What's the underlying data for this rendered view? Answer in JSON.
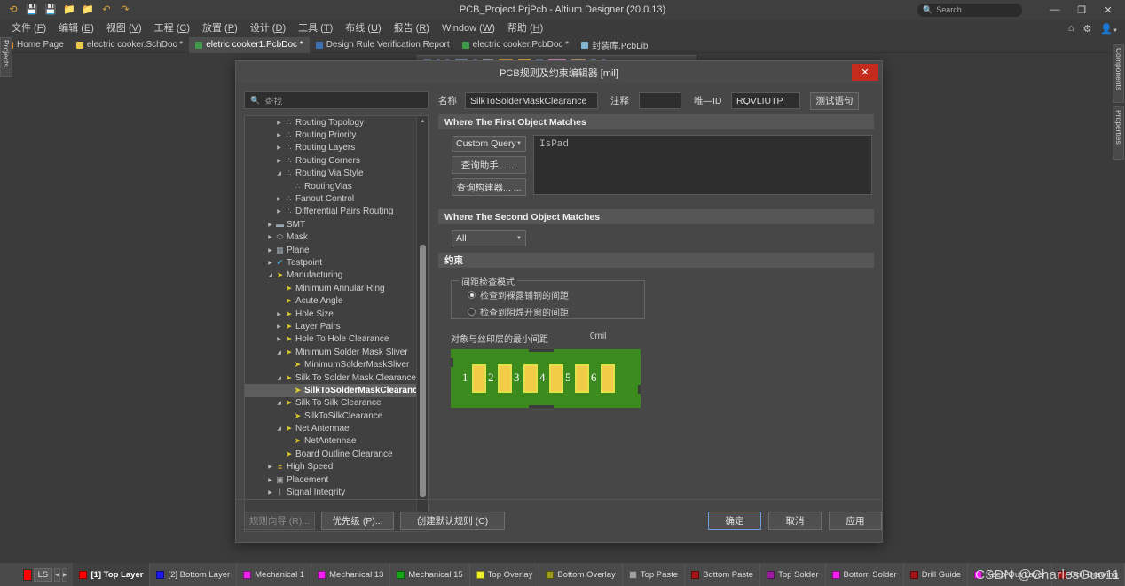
{
  "titlebar": {
    "title": "PCB_Project.PrjPcb - Altium Designer (20.0.13)",
    "search_placeholder": "Search",
    "minimize": "—",
    "maximize": "❐",
    "close": "✕",
    "icons": [
      "logo-icon",
      "save-icon",
      "save-all-icon",
      "open-icon",
      "open-project-icon",
      "undo-icon",
      "redo-icon"
    ]
  },
  "menubar": {
    "items": [
      {
        "text": "文件",
        "key": "F"
      },
      {
        "text": "编辑",
        "key": "E"
      },
      {
        "text": "视图",
        "key": "V"
      },
      {
        "text": "工程",
        "key": "C"
      },
      {
        "text": "放置",
        "key": "P"
      },
      {
        "text": "设计",
        "key": "D"
      },
      {
        "text": "工具",
        "key": "T"
      },
      {
        "text": "布线",
        "key": "U"
      },
      {
        "text": "报告",
        "key": "R"
      },
      {
        "text": "Window",
        "key": "W"
      },
      {
        "text": "帮助",
        "key": "H"
      }
    ],
    "right_icons": [
      "home-icon",
      "gear-icon",
      "account-icon"
    ]
  },
  "tabs": [
    {
      "label": "Home Page",
      "icon_color": "#e08a2e",
      "active": false
    },
    {
      "label": "electric cooker.SchDoc *",
      "icon_color": "#e8c84a",
      "active": false
    },
    {
      "label": "eletric cooker1.PcbDoc *",
      "icon_color": "#3f9a4a",
      "active": true
    },
    {
      "label": "Design Rule Verification Report",
      "icon_color": "#3d6fb5",
      "active": false
    },
    {
      "label": "electric cooker.PcbDoc *",
      "icon_color": "#3f9a4a",
      "active": false
    },
    {
      "label": "封装库.PcbLib",
      "icon_color": "#7fb7d4",
      "active": false
    }
  ],
  "panels": {
    "left_vertical": "Projects",
    "right_vertical": [
      "Components",
      "Properties"
    ]
  },
  "dialog": {
    "title": "PCB规则及约束编辑器 [mil]",
    "close_label": "✕",
    "search_placeholder": "查找",
    "fields": {
      "name_label": "名称",
      "name_value": "SilkToSolderMaskClearance",
      "comment_label": "注释",
      "comment_value": "",
      "uid_label": "唯—ID",
      "uid_value": "RQVLIUTP",
      "test_button": "测试语句"
    },
    "first_object": {
      "header": "Where The First Object Matches",
      "scope": "Custom Query",
      "query_helper_button": "查询助手... ...",
      "query_builder_button": "查询构建器... ...",
      "query_text": "IsPad"
    },
    "second_object": {
      "header": "Where The Second Object Matches",
      "scope": "All"
    },
    "constraints": {
      "header": "约束",
      "group_legend": "间距检查模式",
      "options": [
        {
          "label": "检查到裸露铺铜的间距",
          "selected": true
        },
        {
          "label": "检查到阻焊开窗的间距",
          "selected": false
        }
      ],
      "clearance_label": "对象与丝印层的最小间距",
      "clearance_value": "0mil"
    },
    "preview": {
      "pad_labels": [
        "1",
        "2",
        "3",
        "4",
        "5",
        "6"
      ],
      "board_color": "#3b8a1e",
      "pad_color": "#f2cc47"
    },
    "footer": {
      "rule_wizard": "规则向导 (R)...",
      "priority": "优先级 (P)...",
      "create_default": "创建默认规则 (C)",
      "ok": "确定",
      "cancel": "取消",
      "apply": "应用"
    }
  },
  "tree": [
    {
      "depth": 3,
      "label": "Routing Topology",
      "expander": "collapsed",
      "icon": "routing-icon"
    },
    {
      "depth": 3,
      "label": "Routing Priority",
      "expander": "collapsed",
      "icon": "routing-icon"
    },
    {
      "depth": 3,
      "label": "Routing Layers",
      "expander": "collapsed",
      "icon": "routing-icon"
    },
    {
      "depth": 3,
      "label": "Routing Corners",
      "expander": "collapsed",
      "icon": "routing-icon"
    },
    {
      "depth": 3,
      "label": "Routing Via Style",
      "expander": "expanded",
      "icon": "routing-icon"
    },
    {
      "depth": 4,
      "label": "RoutingVias",
      "expander": "none",
      "icon": "routing-icon"
    },
    {
      "depth": 3,
      "label": "Fanout Control",
      "expander": "collapsed",
      "icon": "routing-icon"
    },
    {
      "depth": 3,
      "label": "Differential Pairs Routing",
      "expander": "collapsed",
      "icon": "routing-icon"
    },
    {
      "depth": 2,
      "label": "SMT",
      "expander": "collapsed",
      "icon": "smt-icon"
    },
    {
      "depth": 2,
      "label": "Mask",
      "expander": "collapsed",
      "icon": "mask-icon"
    },
    {
      "depth": 2,
      "label": "Plane",
      "expander": "collapsed",
      "icon": "plane-icon"
    },
    {
      "depth": 2,
      "label": "Testpoint",
      "expander": "collapsed",
      "icon": "testpoint-icon"
    },
    {
      "depth": 2,
      "label": "Manufacturing",
      "expander": "expanded",
      "icon": "manufacturing-icon"
    },
    {
      "depth": 3,
      "label": "Minimum Annular Ring",
      "expander": "none",
      "icon": "manufacturing-icon"
    },
    {
      "depth": 3,
      "label": "Acute Angle",
      "expander": "none",
      "icon": "manufacturing-icon"
    },
    {
      "depth": 3,
      "label": "Hole Size",
      "expander": "collapsed",
      "icon": "manufacturing-icon"
    },
    {
      "depth": 3,
      "label": "Layer Pairs",
      "expander": "collapsed",
      "icon": "manufacturing-icon"
    },
    {
      "depth": 3,
      "label": "Hole To Hole Clearance",
      "expander": "collapsed",
      "icon": "manufacturing-icon"
    },
    {
      "depth": 3,
      "label": "Minimum Solder Mask Sliver",
      "expander": "expanded",
      "icon": "manufacturing-icon"
    },
    {
      "depth": 4,
      "label": "MinimumSolderMaskSliver",
      "expander": "none",
      "icon": "manufacturing-icon"
    },
    {
      "depth": 3,
      "label": "Silk To Solder Mask Clearance",
      "expander": "expanded",
      "icon": "manufacturing-icon"
    },
    {
      "depth": 4,
      "label": "SilkToSolderMaskClearance",
      "expander": "none",
      "icon": "manufacturing-icon",
      "selected": true
    },
    {
      "depth": 3,
      "label": "Silk To Silk Clearance",
      "expander": "expanded",
      "icon": "manufacturing-icon"
    },
    {
      "depth": 4,
      "label": "SilkToSilkClearance",
      "expander": "none",
      "icon": "manufacturing-icon"
    },
    {
      "depth": 3,
      "label": "Net Antennae",
      "expander": "expanded",
      "icon": "manufacturing-icon"
    },
    {
      "depth": 4,
      "label": "NetAntennae",
      "expander": "none",
      "icon": "manufacturing-icon"
    },
    {
      "depth": 3,
      "label": "Board Outline Clearance",
      "expander": "none",
      "icon": "manufacturing-icon"
    },
    {
      "depth": 2,
      "label": "High Speed",
      "expander": "collapsed",
      "icon": "highspeed-icon"
    },
    {
      "depth": 2,
      "label": "Placement",
      "expander": "collapsed",
      "icon": "placement-icon"
    },
    {
      "depth": 2,
      "label": "Signal Integrity",
      "expander": "collapsed",
      "icon": "signal-icon"
    }
  ],
  "layerbar": {
    "ls_label": "LS",
    "ls_color": "#ff0000",
    "prev_arrow": "◀",
    "next_arrow": "▶",
    "layers": [
      {
        "label": "[1] Top Layer",
        "color": "#ff0000",
        "active": true
      },
      {
        "label": "[2] Bottom Layer",
        "color": "#1a1ae6",
        "active": false
      },
      {
        "label": "Mechanical 1",
        "color": "#ea23ea",
        "active": false
      },
      {
        "label": "Mechanical 13",
        "color": "#f51ef5",
        "active": false
      },
      {
        "label": "Mechanical 15",
        "color": "#16a616",
        "active": false
      },
      {
        "label": "Top Overlay",
        "color": "#f0f02a",
        "active": false
      },
      {
        "label": "Bottom Overlay",
        "color": "#9c9c1b",
        "active": false
      },
      {
        "label": "Top Paste",
        "color": "#9e9e9e",
        "active": false
      },
      {
        "label": "Bottom Paste",
        "color": "#a41414",
        "active": false
      },
      {
        "label": "Top Solder",
        "color": "#9c1a9c",
        "active": false
      },
      {
        "label": "Bottom Solder",
        "color": "#f51ef5",
        "active": false
      },
      {
        "label": "Drill Guide",
        "color": "#a41414",
        "active": false
      },
      {
        "label": "Keep-Out Layer",
        "color": "#f51ef5",
        "active": false
      },
      {
        "label": "Drill Drawing",
        "color": "#a41414",
        "active": false
      }
    ],
    "watermark": "CSDN @CharlesGuo11"
  }
}
